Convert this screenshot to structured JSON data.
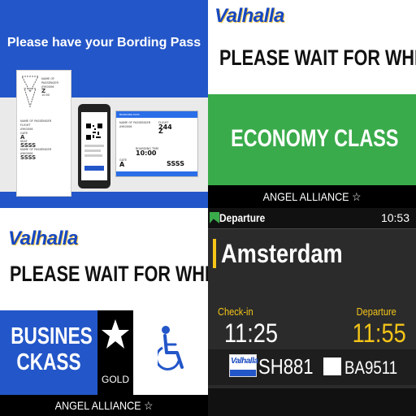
{
  "boarding": {
    "title": "Please have your Bording Pass",
    "ticket": {
      "name_label": "NAME OF PASSENGER",
      "big1": "Z",
      "big2": "A",
      "code": "AYK0006",
      "seat": "SSSS",
      "time": "10:00",
      "flight_label": "FLIGHT",
      "gate_label": "GATE",
      "seat_label": "SEAT"
    },
    "card": {
      "header": "BOARDING PASS",
      "flight_label": "FLIGHT",
      "code": "AYK0006",
      "num": "244",
      "big": "Z",
      "time_label": "BOARDING TIME",
      "time": "10:00",
      "gate_label": "GATE",
      "gate": "A",
      "seat": "SSSS"
    }
  },
  "economy": {
    "brand": "Valhalla",
    "wait": "PLEASE WAIT FOR WHILE",
    "class_label": "ECONOMY CLASS",
    "alliance": "ANGEL ALLIANCE ☆"
  },
  "business": {
    "brand": "Valhalla",
    "wait": "PLEASE WAIT FOR WHILE",
    "class_line1": "BUSINES",
    "class_line2": "CKASS",
    "gold": "GOLD",
    "alliance": "ANGEL ALLIANCE ☆"
  },
  "departure": {
    "header": "Departure",
    "clock": "10:53",
    "city": "Amsterdam",
    "checkin_label": "Check-in",
    "checkin_time": "11:25",
    "departure_label": "Departure",
    "departure_time": "11:55",
    "badge": "Valhalla",
    "flight1": "SH881",
    "flight2": "BA9511",
    "colors": {
      "accent": "#f5c518",
      "green": "#3aab4b"
    }
  }
}
